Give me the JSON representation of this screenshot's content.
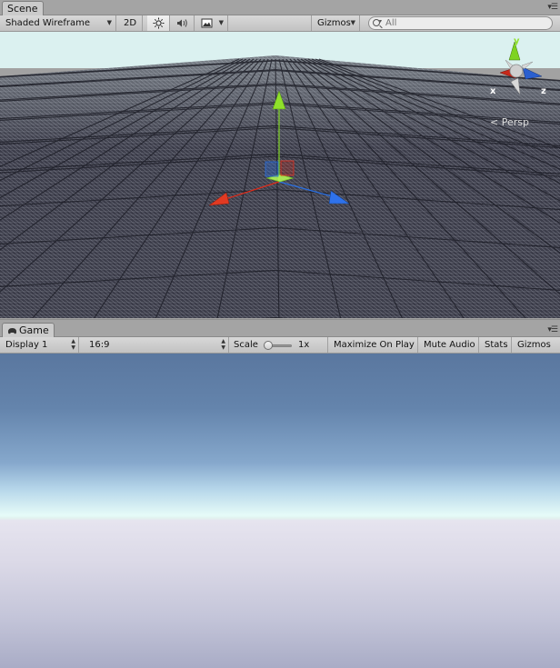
{
  "scene": {
    "tab_label": "Scene",
    "toolbar": {
      "shading_mode": "Shaded Wireframe",
      "mode_2d": "2D",
      "gizmos_label": "Gizmos",
      "search_placeholder": "All"
    },
    "view": {
      "axis_labels": {
        "x": "x",
        "y": "y",
        "z": "z"
      },
      "projection_label": "< Persp"
    }
  },
  "game": {
    "tab_label": "Game",
    "toolbar": {
      "display": "Display 1",
      "aspect": "16:9",
      "scale_label": "Scale",
      "scale_value": "1x",
      "maximize_on_play": "Maximize On Play",
      "mute_audio": "Mute Audio",
      "stats": "Stats",
      "gizmos": "Gizmos"
    }
  },
  "icons": {
    "panel_menu": "panel-menu-icon",
    "lighting": "sun-icon",
    "audio": "speaker-icon",
    "effects": "image-icon",
    "search": "search-icon",
    "game_tab": "game-controller-icon"
  },
  "colors": {
    "x_axis": "#e02b19",
    "y_axis": "#7ed321",
    "z_axis": "#2a6fe0",
    "scene_background": "#3d3d48",
    "wireframe": "#b4b6c6"
  }
}
